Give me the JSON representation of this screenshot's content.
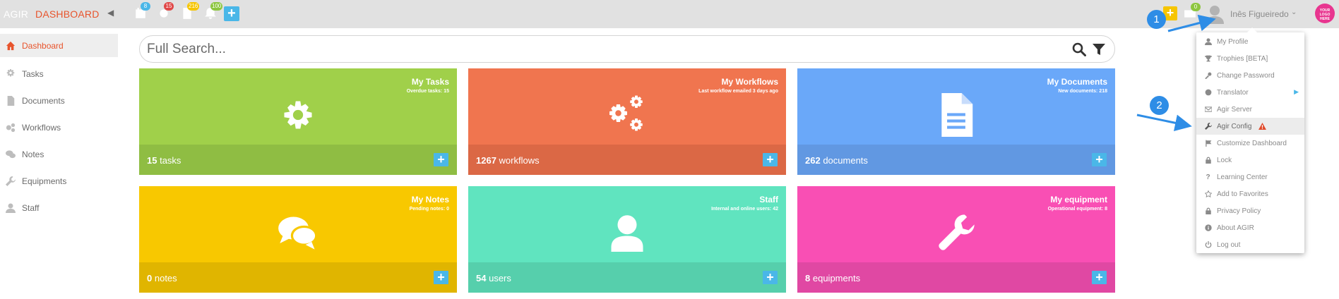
{
  "topbar": {
    "brand_left": "AGIR",
    "brand_right": "DASHBOARD",
    "collapse_icon": "caret-left-icon",
    "notifications": [
      {
        "icon": "calendar-icon",
        "count": "8",
        "color": "#4ab7e8"
      },
      {
        "icon": "gear-icon",
        "count": "15",
        "color": "#e04848"
      },
      {
        "icon": "document-icon",
        "count": "216",
        "color": "#f6c500"
      },
      {
        "icon": "bell-icon",
        "count": "100",
        "color": "#8dc63f"
      }
    ],
    "add_label": "+",
    "quick_add_label": "+",
    "messages_count": "0",
    "user_name": "Inês Figueiredo",
    "user_caret": "⌄",
    "logo_text": "YOUR LOGO HERE"
  },
  "sidebar": {
    "items": [
      {
        "label": "Dashboard",
        "icon": "home-icon",
        "active": true
      },
      {
        "label": "Tasks",
        "icon": "gear-icon"
      },
      {
        "label": "Documents",
        "icon": "document-icon"
      },
      {
        "label": "Workflows",
        "icon": "gears-icon"
      },
      {
        "label": "Notes",
        "icon": "chat-icon"
      },
      {
        "label": "Equipments",
        "icon": "wrench-icon"
      },
      {
        "label": "Staff",
        "icon": "user-icon"
      }
    ]
  },
  "search": {
    "placeholder": "Full Search...",
    "search_icon": "search-icon",
    "filter_icon": "filter-icon"
  },
  "tiles": [
    {
      "title": "My Tasks",
      "subtitle": "Overdue tasks: 15",
      "count": "15",
      "unit": "tasks",
      "icon": "gear-icon",
      "color": "#a0d04a",
      "foot_color": "#8fbd43"
    },
    {
      "title": "My Workflows",
      "subtitle": "Last workflow emailed 3 days ago",
      "count": "1267",
      "unit": "workflows",
      "icon": "gears-icon",
      "color": "#f0754f",
      "foot_color": "#db6845"
    },
    {
      "title": "My Documents",
      "subtitle": "New documents: 218",
      "count": "262",
      "unit": "documents",
      "icon": "document-icon",
      "color": "#6aa8f9",
      "foot_color": "#6198e2"
    },
    {
      "title": "My Notes",
      "subtitle": "Pending notes: 0",
      "count": "0",
      "unit": "notes",
      "icon": "chat-icon",
      "color": "#f8c800",
      "foot_color": "#e0b500"
    },
    {
      "title": "Staff",
      "subtitle": "Internal and online users: 42",
      "count": "54",
      "unit": "users",
      "icon": "user-icon",
      "color": "#60e4bf",
      "foot_color": "#56cfac"
    },
    {
      "title": "My equipment",
      "subtitle": "Operational equipment: 8",
      "count": "8",
      "unit": "equipments",
      "icon": "wrench-icon",
      "color": "#f94fb4",
      "foot_color": "#e048a3"
    }
  ],
  "tile_add_label": "+",
  "user_menu": {
    "items": [
      {
        "label": "My Profile",
        "icon": "user-icon"
      },
      {
        "label": "Trophies [BETA]",
        "icon": "trophy-icon"
      },
      {
        "label": "Change Password",
        "icon": "key-icon"
      },
      {
        "label": "Translator",
        "icon": "globe-icon",
        "has_submenu": true
      },
      {
        "label": "Agir Server",
        "icon": "envelope-icon"
      },
      {
        "label": "Agir Config",
        "icon": "wrench-icon",
        "highlighted": true,
        "warning": true
      },
      {
        "label": "Customize Dashboard",
        "icon": "flag-icon"
      },
      {
        "label": "Lock",
        "icon": "lock-icon"
      },
      {
        "label": "Learning Center",
        "icon": "question-icon"
      },
      {
        "label": "Add to Favorites",
        "icon": "star-icon"
      },
      {
        "label": "Privacy Policy",
        "icon": "lock-icon"
      },
      {
        "label": "About AGIR",
        "icon": "info-icon"
      },
      {
        "label": "Log out",
        "icon": "power-icon"
      }
    ]
  },
  "annotations": [
    {
      "label": "1"
    },
    {
      "label": "2"
    }
  ],
  "colors": {
    "accent": "#e8542c",
    "plus_button": "#4ab7e8",
    "callout": "#2e8de6"
  }
}
